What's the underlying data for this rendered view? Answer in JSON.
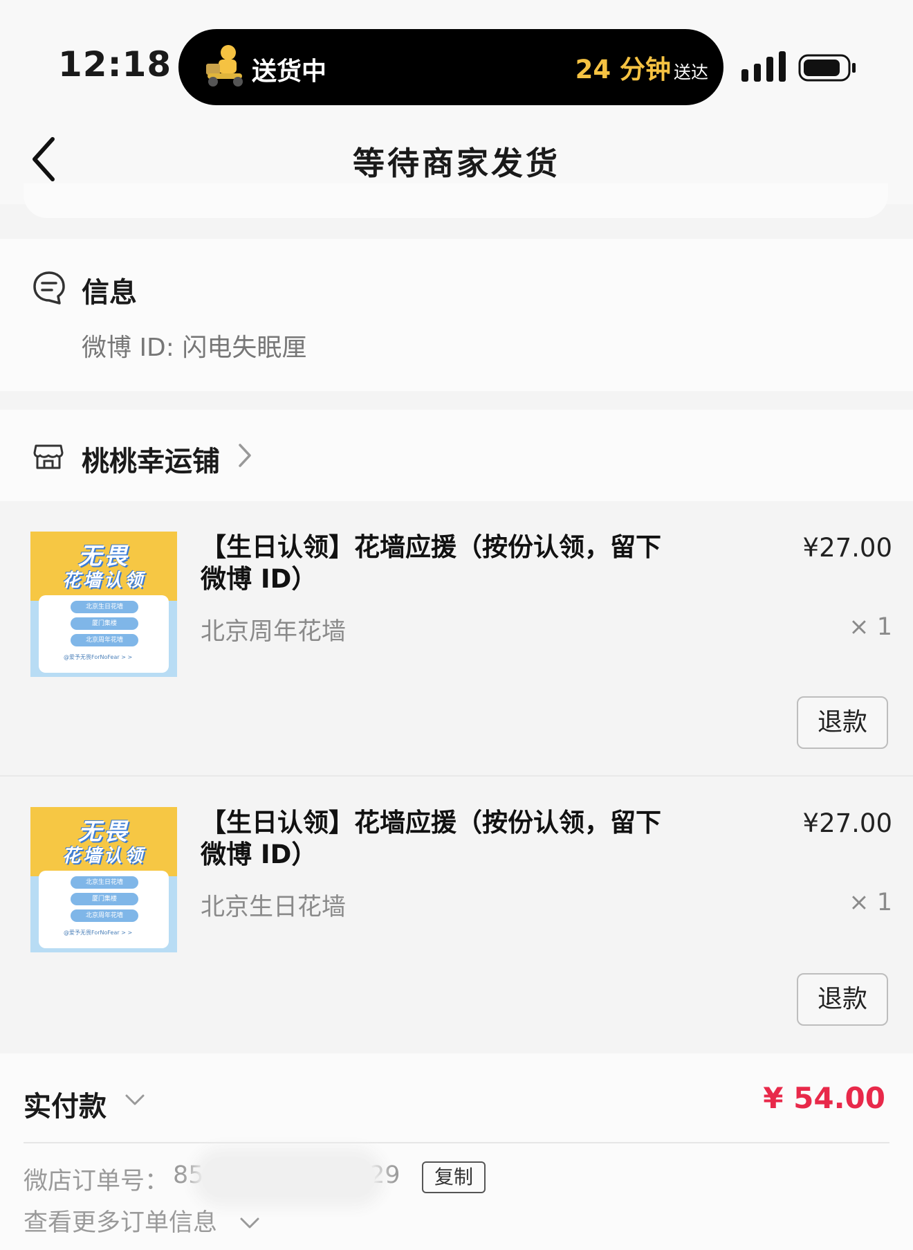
{
  "status_bar": {
    "time": "12:18",
    "live_activity": {
      "status": "送货中",
      "eta": "24 分钟",
      "eta_suffix": "送达",
      "eta_color": "#f5c242"
    }
  },
  "nav": {
    "title": "等待商家发货"
  },
  "info": {
    "title": "信息",
    "line": "微博 ID: 闪电失眠厘"
  },
  "shop": {
    "name": "桃桃幸运铺"
  },
  "thumbnail": {
    "line1": "无畏",
    "line2": "花墙认领",
    "pills": [
      "北京生日花墙",
      "厦门集楼",
      "北京周年花墙"
    ],
    "footer": "@爱予无畏ForNoFear  > >"
  },
  "items": [
    {
      "title": "【生日认领】花墙应援（按份认领，留下微博 ID）",
      "variant": "北京周年花墙",
      "price": "¥27.00",
      "quantity": "× 1",
      "refund_label": "退款"
    },
    {
      "title": "【生日认领】花墙应援（按份认领，留下微博 ID）",
      "variant": "北京生日花墙",
      "price": "¥27.00",
      "quantity": "× 1",
      "refund_label": "退款"
    }
  ],
  "payment": {
    "label": "实付款",
    "amount": "¥ 54.00",
    "amount_color": "#e8294a"
  },
  "order": {
    "label": "微店订单号：",
    "number_start": "85",
    "number_end": "29",
    "copy_label": "复制",
    "more_label": "查看更多订单信息"
  }
}
